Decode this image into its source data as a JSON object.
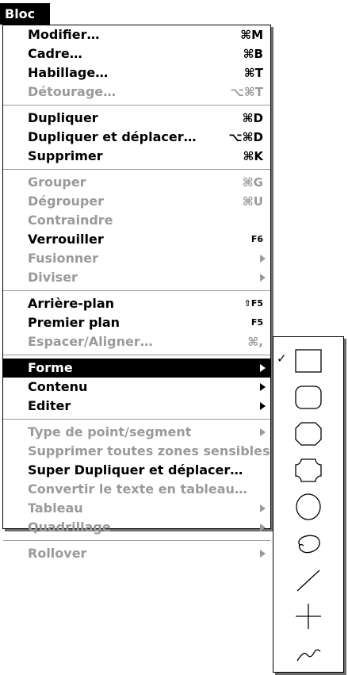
{
  "menu": {
    "title": "Bloc",
    "items": [
      {
        "label": "Modifier…",
        "shortcut": "⌘M",
        "enabled": true
      },
      {
        "label": "Cadre…",
        "shortcut": "⌘B",
        "enabled": true
      },
      {
        "label": "Habillage…",
        "shortcut": "⌘T",
        "enabled": true
      },
      {
        "label": "Détourage…",
        "shortcut": "⌥⌘T",
        "enabled": false
      },
      {
        "label": "Dupliquer",
        "shortcut": "⌘D",
        "enabled": true
      },
      {
        "label": "Dupliquer et déplacer…",
        "shortcut": "⌥⌘D",
        "enabled": true
      },
      {
        "label": "Supprimer",
        "shortcut": "⌘K",
        "enabled": true
      },
      {
        "label": "Grouper",
        "shortcut": "⌘G",
        "enabled": false
      },
      {
        "label": "Dégrouper",
        "shortcut": "⌘U",
        "enabled": false
      },
      {
        "label": "Contraindre",
        "shortcut": "",
        "enabled": false
      },
      {
        "label": "Verrouiller",
        "shortcut": "F6",
        "enabled": true
      },
      {
        "label": "Fusionner",
        "shortcut": "",
        "enabled": false,
        "submenu": true
      },
      {
        "label": "Diviser",
        "shortcut": "",
        "enabled": false,
        "submenu": true
      },
      {
        "label": "Arrière-plan",
        "shortcut": "⇧F5",
        "enabled": true
      },
      {
        "label": "Premier plan",
        "shortcut": "F5",
        "enabled": true
      },
      {
        "label": "Espacer/Aligner…",
        "shortcut": "⌘,",
        "enabled": false
      },
      {
        "label": "Forme",
        "shortcut": "",
        "enabled": true,
        "submenu": true,
        "highlighted": true
      },
      {
        "label": "Contenu",
        "shortcut": "",
        "enabled": true,
        "submenu": true
      },
      {
        "label": "Editer",
        "shortcut": "",
        "enabled": true,
        "submenu": true
      },
      {
        "label": "Type de point/segment",
        "shortcut": "",
        "enabled": false,
        "submenu": true
      },
      {
        "label": "Supprimer toutes zones sensibles",
        "shortcut": "",
        "enabled": false
      },
      {
        "label": "Super Dupliquer et déplacer…",
        "shortcut": "",
        "enabled": true
      },
      {
        "label": "Convertir le texte en tableau…",
        "shortcut": "",
        "enabled": false
      },
      {
        "label": "Tableau",
        "shortcut": "",
        "enabled": false,
        "submenu": true
      },
      {
        "label": "Quadrillage",
        "shortcut": "",
        "enabled": false,
        "submenu": true
      },
      {
        "label": "Rollover",
        "shortcut": "",
        "enabled": false,
        "submenu": true
      }
    ]
  },
  "forme_submenu": {
    "checkmark": "✓",
    "items": [
      {
        "icon": "rectangle-shape-icon",
        "checked": true
      },
      {
        "icon": "rounded-rectangle-shape-icon",
        "checked": false
      },
      {
        "icon": "beveled-rectangle-shape-icon",
        "checked": false
      },
      {
        "icon": "concave-rectangle-shape-icon",
        "checked": false
      },
      {
        "icon": "oval-shape-icon",
        "checked": false
      },
      {
        "icon": "bezier-freeform-shape-icon",
        "checked": false
      },
      {
        "icon": "diagonal-line-shape-icon",
        "checked": false
      },
      {
        "icon": "orthogonal-line-shape-icon",
        "checked": false
      },
      {
        "icon": "bezier-line-shape-icon",
        "checked": false
      }
    ]
  }
}
